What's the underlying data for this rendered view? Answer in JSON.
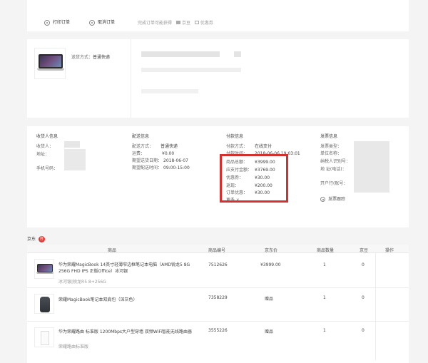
{
  "actions": {
    "print_label": "打印订单",
    "cancel_label": "取消订单",
    "gain_label": "完成订单可能获得",
    "points_label": "京豆",
    "coupon_label": "优惠券"
  },
  "shipment": {
    "method_label": "送货方式：",
    "method_value": "普通快递"
  },
  "receiver": {
    "title": "收货人信息",
    "name_label": "收货人：",
    "address_label": "地址：",
    "phone_label": "手机号码："
  },
  "delivery": {
    "title": "配送信息",
    "method_label": "配送方式：",
    "method_value": "普通快递",
    "fee_label": "运费：",
    "fee_value": "¥0.00",
    "date_label": "期望送货日期：",
    "date_value": "2018-06-07",
    "time_label": "期望配送时间：",
    "time_value": "09:00-15:00"
  },
  "payment": {
    "title": "付款信息",
    "method_label": "付款方式：",
    "method_value": "在线支付",
    "time_label": "付款时间：",
    "time_value": "2018-06-06 19:03:01",
    "total_label": "商品总额：",
    "total_value": "¥3999.00",
    "payable_label": "应支付金额：",
    "payable_value": "¥3769.00",
    "coupon_label": "优惠券：",
    "coupon_value": "¥30.00",
    "rebate_label": "返现：",
    "rebate_value": "¥200.00",
    "discount_label": "订单优惠：",
    "discount_value": "¥30.00",
    "more_label": "更多"
  },
  "invoice": {
    "title": "发票信息",
    "type_label": "发票类型：",
    "unit_label": "单位名称：",
    "tax_label": "纳税人识别号：",
    "addr_label": "地 址(电话)：",
    "bank_label": "开户行(账号：",
    "follow_label": "发票跟踪"
  },
  "seller": {
    "name": "京东",
    "badge": "自"
  },
  "table": {
    "headers": [
      "商品",
      "商品编号",
      "京东价",
      "商品数量",
      "京豆",
      "操作"
    ],
    "rows": [
      {
        "name": "华为荣耀MagicBook 14英寸轻薄窄边框笔记本电脑（AMD锐龙5 8G 256G FHD IPS 正版Office）冰河银",
        "sub": "冰河银|锐龙R5 8+256G",
        "sku": "7512626",
        "price": "¥3999.00",
        "qty": "1",
        "beans": "0"
      },
      {
        "name": "荣耀MagicBook笔记本双肩包（深灰色）",
        "sub": "",
        "sku": "7358229",
        "price": "赠品",
        "qty": "1",
        "beans": "0"
      },
      {
        "name": "华为荣耀路由 标准版 1200Mbps大户型穿墙 双频WiFi智能无线路由器",
        "sub": "荣耀路由标准版",
        "sku": "3555226",
        "price": "赠品",
        "qty": "1",
        "beans": "0"
      }
    ]
  },
  "colors": {
    "highlight": "#d43030",
    "badge": "#e53935"
  }
}
